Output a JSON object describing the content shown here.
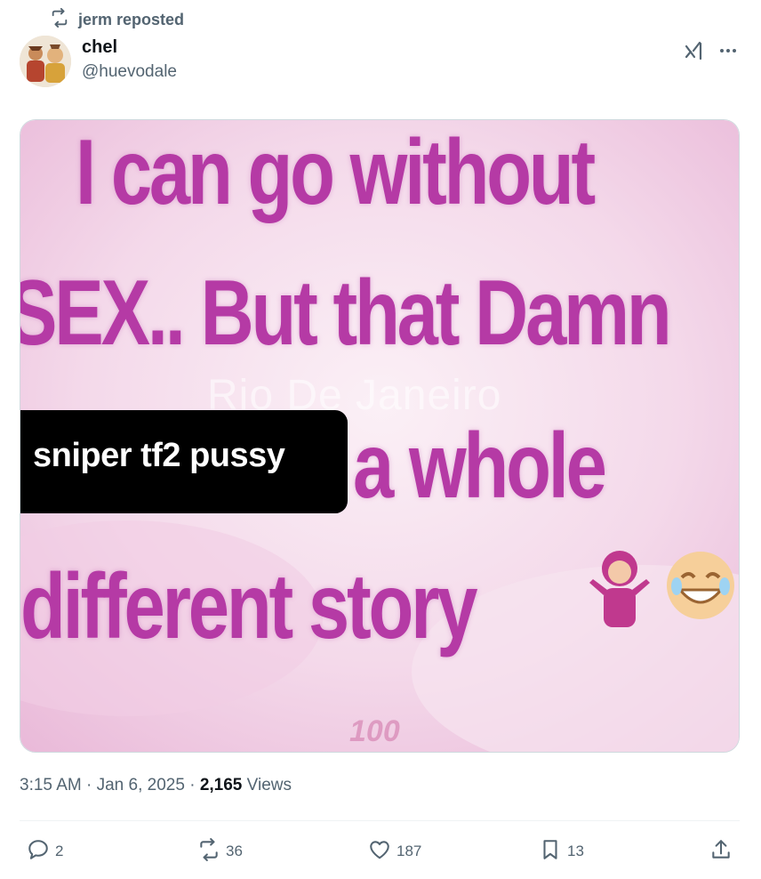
{
  "repost": {
    "label": "jerm reposted",
    "icon": "repost-icon"
  },
  "author": {
    "name": "chel",
    "handle": "@huevodale",
    "avatar": "avatar"
  },
  "header_actions": {
    "grok_icon": "grok-icon",
    "more_icon": "more-icon"
  },
  "media": {
    "meme_lines": [
      "I can go without",
      "SEX.. But that Damn",
      "a whole",
      "different story"
    ],
    "watermark": "Rio De Janeiro",
    "stamp": "100",
    "caption": "sniper tf2 pussy",
    "colors": {
      "meme_text": "#b53aa5",
      "background": "#f5e6f1"
    }
  },
  "meta": {
    "time": "3:15 AM",
    "separator": "·",
    "date": "Jan 6, 2025",
    "views_count": "2,165",
    "views_label": "Views"
  },
  "actions": {
    "reply_count": "2",
    "repost_count": "36",
    "like_count": "187",
    "bookmark_count": "13"
  },
  "colors": {
    "text_primary": "#0f1419",
    "text_secondary": "#536471",
    "divider": "#eff3f4"
  }
}
